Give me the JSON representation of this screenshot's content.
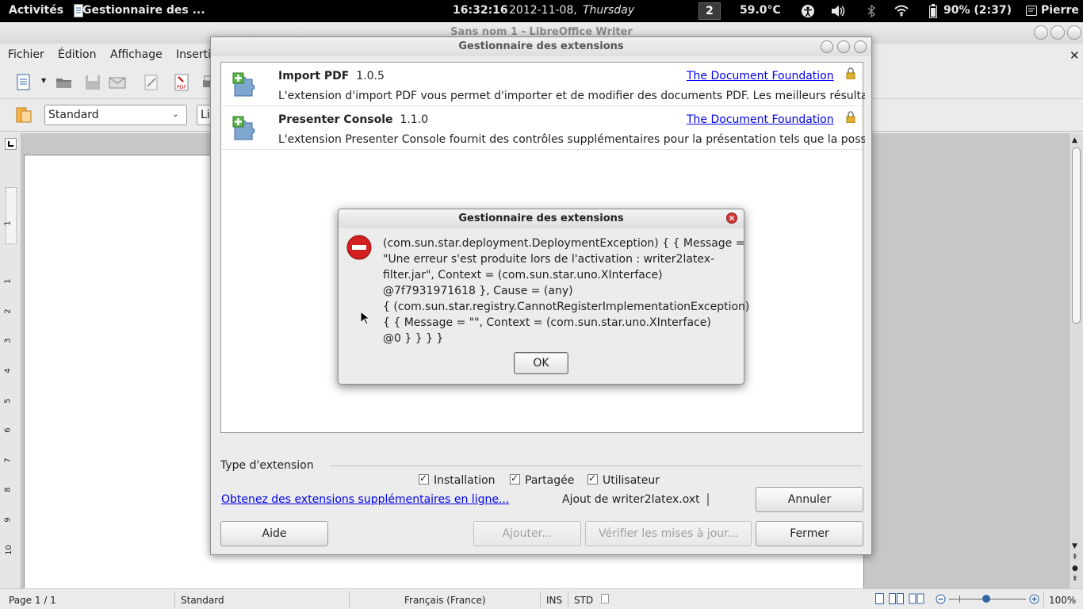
{
  "topbar": {
    "activities": "Activités",
    "app_name": "Gestionnaire des ...",
    "clock_time": "16:32:16",
    "clock_date": "2012-11-08,",
    "clock_day": "Thursday",
    "workspace": "2",
    "temperature": "59.0°C",
    "battery": "90% (2:37)",
    "user": "Pierre"
  },
  "writer": {
    "title": "Sans nom 1 - LibreOffice Writer",
    "menu": [
      "Fichier",
      "Édition",
      "Affichage",
      "Inserti"
    ],
    "style_combo": "Standard",
    "font_combo": "Li",
    "status": {
      "page": "Page 1 / 1",
      "style": "Standard",
      "language": "Français (France)",
      "ins": "INS",
      "std": "STD",
      "zoom": "100%"
    },
    "ruler_numbers": [
      "1",
      "1",
      "2",
      "3",
      "4",
      "5",
      "6",
      "7",
      "8",
      "9",
      "10"
    ]
  },
  "extmgr": {
    "title": "Gestionnaire des extensions",
    "extensions": [
      {
        "name": "Import PDF",
        "version": "1.0.5",
        "publisher": "The Document Foundation",
        "description": "L'extension d'import PDF vous permet d'importer et de modifier des documents PDF. Les meilleurs résultat..."
      },
      {
        "name": "Presenter Console",
        "version": "1.1.0",
        "publisher": "The Document Foundation",
        "description": "L'extension Presenter Console fournit des contrôles supplémentaires pour la présentation tels que la possi..."
      }
    ],
    "type_label": "Type d'extension",
    "checkboxes": {
      "installation": "Installation",
      "shared": "Partagée",
      "user": "Utilisateur"
    },
    "get_more_link": "Obtenez des extensions supplémentaires en ligne...",
    "adding_status": "Ajout de writer2latex.oxt",
    "buttons": {
      "cancel": "Annuler",
      "help": "Aide",
      "add": "Ajouter...",
      "check_updates": "Vérifier les mises à jour...",
      "close": "Fermer"
    }
  },
  "error_dialog": {
    "title": "Gestionnaire des extensions",
    "message_lines": [
      "(com.sun.star.deployment.DeploymentException) { { Message =",
      "\"Une erreur s'est produite lors de l'activation : writer2latex-",
      "filter.jar\", Context = (com.sun.star.uno.XInterface)",
      "@7f7931971618 }, Cause = (any)",
      "{ (com.sun.star.registry.CannotRegisterImplementationException)",
      "{ { Message = \"\", Context = (com.sun.star.uno.XInterface)",
      "@0 } } } }"
    ],
    "ok": "OK"
  },
  "colors": {
    "link": "#0000ee",
    "error_red": "#d21f1f",
    "topbar_bg": "#000000"
  }
}
